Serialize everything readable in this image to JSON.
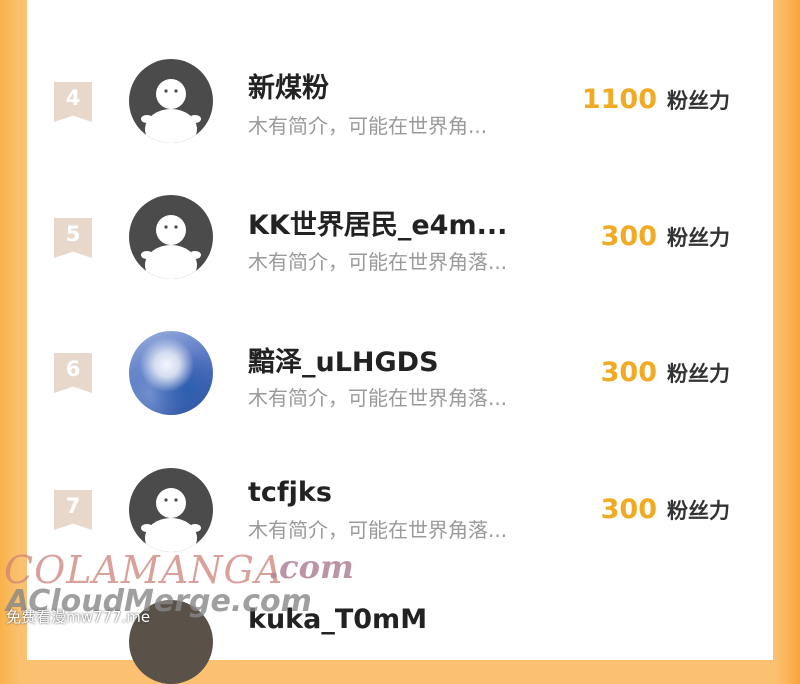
{
  "watermark": {
    "brand_a": "COLAMANGA",
    "brand_b": ".com",
    "brand_c": "ACloudMerge.com",
    "brand_d": "免费看漫mw777.me"
  },
  "fan_unit": "粉丝力",
  "rows": [
    {
      "rank": "4",
      "name": "新煤粉",
      "bio": "木有简介，可能在世界角...",
      "fans": "1100",
      "avatar": "default"
    },
    {
      "rank": "5",
      "name": "KK世界居民_e4m...",
      "bio": "木有简介，可能在世界角落...",
      "fans": "300",
      "avatar": "default"
    },
    {
      "rank": "6",
      "name": "黯泽_uLHGDS",
      "bio": "木有简介，可能在世界角落...",
      "fans": "300",
      "avatar": "photo"
    },
    {
      "rank": "7",
      "name": "tcfjks",
      "bio": "木有简介，可能在世界角落...",
      "fans": "300",
      "avatar": "default"
    }
  ],
  "partial_row": {
    "name": "kuka_T0mM"
  },
  "colors": {
    "accent": "#f0aa23",
    "rank_badge": "#e7d8cb",
    "background": "#fbc170"
  }
}
